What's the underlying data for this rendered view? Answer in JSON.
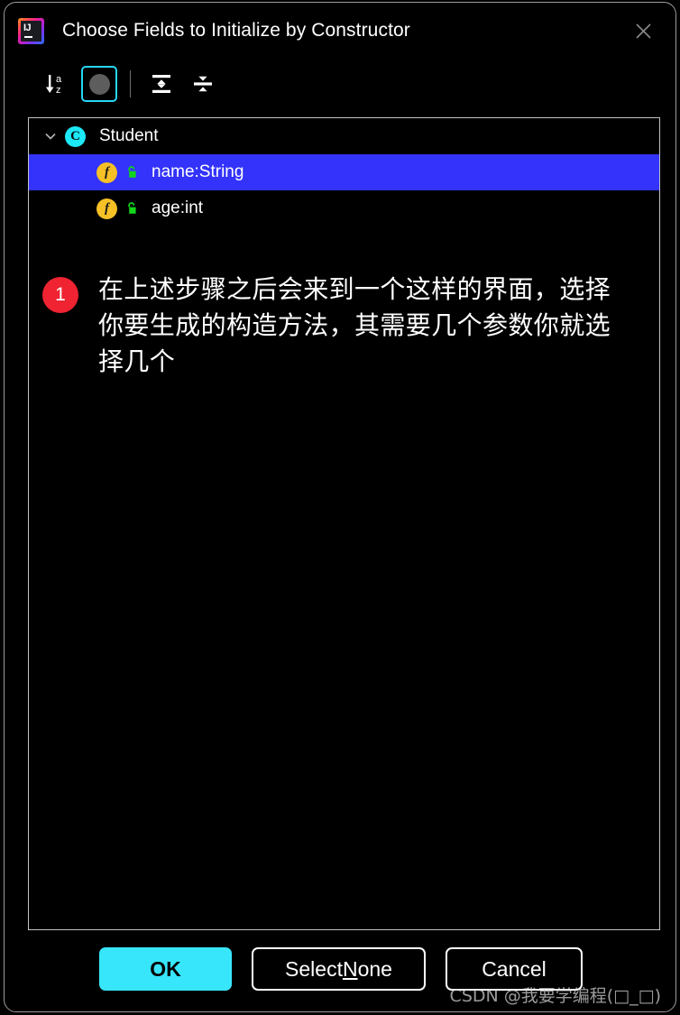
{
  "window": {
    "title": "Choose Fields to Initialize by Constructor",
    "app_icon": "intellij-idea-icon",
    "close_icon": "close-icon"
  },
  "toolbar": {
    "items": [
      {
        "name": "sort-alphabetically-button",
        "icon": "sort-alphabetically-icon",
        "selected": false
      },
      {
        "name": "group-toggle-button",
        "icon": "filled-circle-icon",
        "selected": true
      },
      {
        "name": "expand-all-button",
        "icon": "expand-all-icon",
        "selected": false
      },
      {
        "name": "collapse-all-button",
        "icon": "collapse-all-icon",
        "selected": false
      }
    ]
  },
  "tree": {
    "class_node": {
      "label": "Student",
      "icon": "class-icon",
      "icon_letter": "C",
      "expanded": true,
      "chevron": "chevron-down-icon"
    },
    "fields": [
      {
        "label": "name:String",
        "icon": "field-icon",
        "icon_letter": "f",
        "visibility_icon": "unlocked-padlock-icon",
        "selected": true
      },
      {
        "label": "age:int",
        "icon": "field-icon",
        "icon_letter": "f",
        "visibility_icon": "unlocked-padlock-icon",
        "selected": false
      }
    ]
  },
  "annotation": {
    "badge": "1",
    "text": "在上述步骤之后会来到一个这样的界面，选择你要生成的构造方法，其需要几个参数你就选择几个"
  },
  "footer": {
    "ok_label": "OK",
    "select_none_prefix": "Select ",
    "select_none_mnemonic": "N",
    "select_none_suffix": "one",
    "cancel_label": "Cancel"
  },
  "watermark": {
    "text": "CSDN @我要学编程(□_□)"
  },
  "colors": {
    "accent_cyan": "#38e6fb",
    "selection_blue": "#3333fb",
    "badge_red": "#ef2331",
    "class_icon_cyan": "#1ce8f7",
    "field_icon_yellow": "#f6c026",
    "lock_green": "#13d51b",
    "panel_border": "#c3c3c3",
    "background": "#000000"
  }
}
